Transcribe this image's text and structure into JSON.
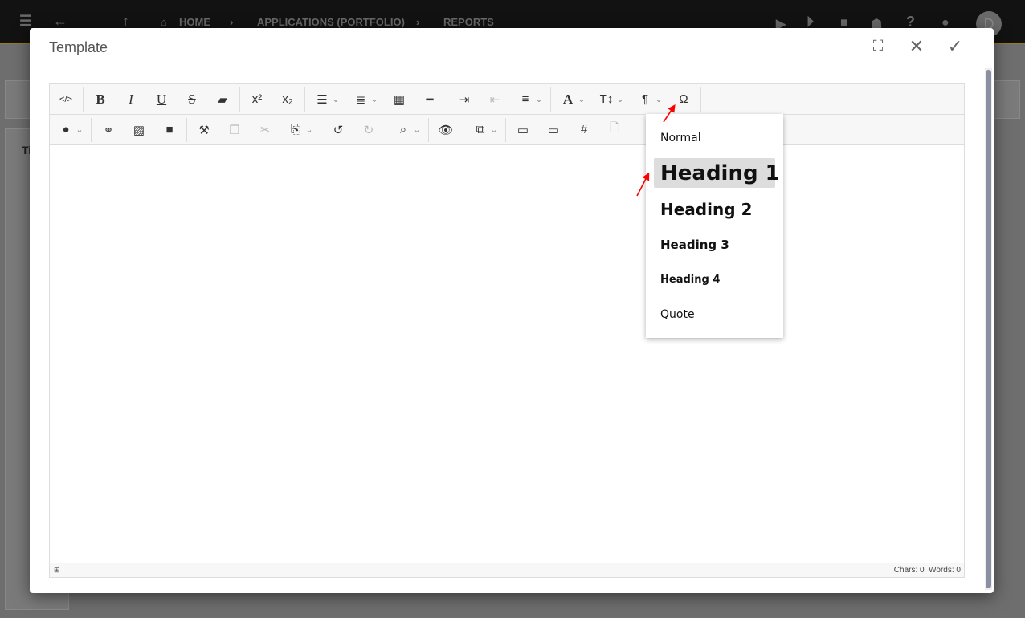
{
  "topbar": {
    "home": "HOME",
    "crumb1": "APPLICATIONS (PORTFOLIO)",
    "crumb2": "REPORTS",
    "avatar": "D"
  },
  "background": {
    "tab_partial": "Ti"
  },
  "modal": {
    "title": "Template"
  },
  "toolbar_row1": [
    {
      "icon": "code-view",
      "g": "</>"
    },
    "sep",
    {
      "icon": "bold",
      "g": "B"
    },
    {
      "icon": "italic",
      "g": "I"
    },
    {
      "icon": "underline",
      "g": "U"
    },
    {
      "icon": "strikethrough",
      "g": "S"
    },
    {
      "icon": "eraser",
      "g": "▰"
    },
    "sep",
    {
      "icon": "superscript",
      "g": "x²"
    },
    {
      "icon": "subscript",
      "g": "x₂"
    },
    "sep",
    {
      "icon": "bullet-list",
      "g": "☰",
      "caret": true
    },
    {
      "icon": "numbered-list",
      "g": "≣",
      "caret": true
    },
    {
      "icon": "table",
      "g": "▦"
    },
    {
      "icon": "horizontal-rule",
      "g": "━"
    },
    "sep",
    {
      "icon": "indent",
      "g": "⇥"
    },
    {
      "icon": "outdent",
      "g": "⇤",
      "dis": true
    },
    {
      "icon": "align",
      "g": "≡",
      "caret": true
    },
    "sep",
    {
      "icon": "font-color",
      "g": "A",
      "caret": true
    },
    {
      "icon": "font-size",
      "g": "T↕",
      "caret": true
    },
    {
      "icon": "paragraph-format",
      "g": "¶",
      "caret": true
    },
    {
      "icon": "special-characters",
      "g": "Ω"
    },
    "sep"
  ],
  "toolbar_row2": [
    {
      "icon": "ink-color",
      "g": "●",
      "caret": true
    },
    "sep",
    {
      "icon": "link",
      "g": "⚭"
    },
    {
      "icon": "image",
      "g": "▨"
    },
    {
      "icon": "video",
      "g": "■"
    },
    "sep",
    {
      "icon": "format-painter",
      "g": "⚒"
    },
    {
      "icon": "copy",
      "g": "❐",
      "dis": true
    },
    {
      "icon": "cut",
      "g": "✂",
      "dis": true
    },
    {
      "icon": "paste",
      "g": "⎘",
      "caret": true
    },
    "sep",
    {
      "icon": "undo",
      "g": "↺"
    },
    {
      "icon": "redo",
      "g": "↻",
      "dis": true
    },
    "sep",
    {
      "icon": "find",
      "g": "⌕",
      "caret": true
    },
    "sep",
    {
      "icon": "preview",
      "g": "👁"
    },
    "sep",
    {
      "icon": "select",
      "g": "⧉",
      "caret": true
    },
    "sep",
    {
      "icon": "header",
      "g": "▭"
    },
    {
      "icon": "footer",
      "g": "▭"
    },
    {
      "icon": "page-number",
      "g": "#"
    },
    {
      "icon": "file",
      "g": "🗋",
      "dis": true
    }
  ],
  "status": {
    "chars": "Chars: 0",
    "words": "Words: 0"
  },
  "paragraph_menu": {
    "items": [
      "Normal",
      "Heading 1",
      "Heading 2",
      "Heading 3",
      "Heading 4",
      "Quote"
    ],
    "selected": "Heading 1"
  },
  "annotation_color": "#ff0000"
}
